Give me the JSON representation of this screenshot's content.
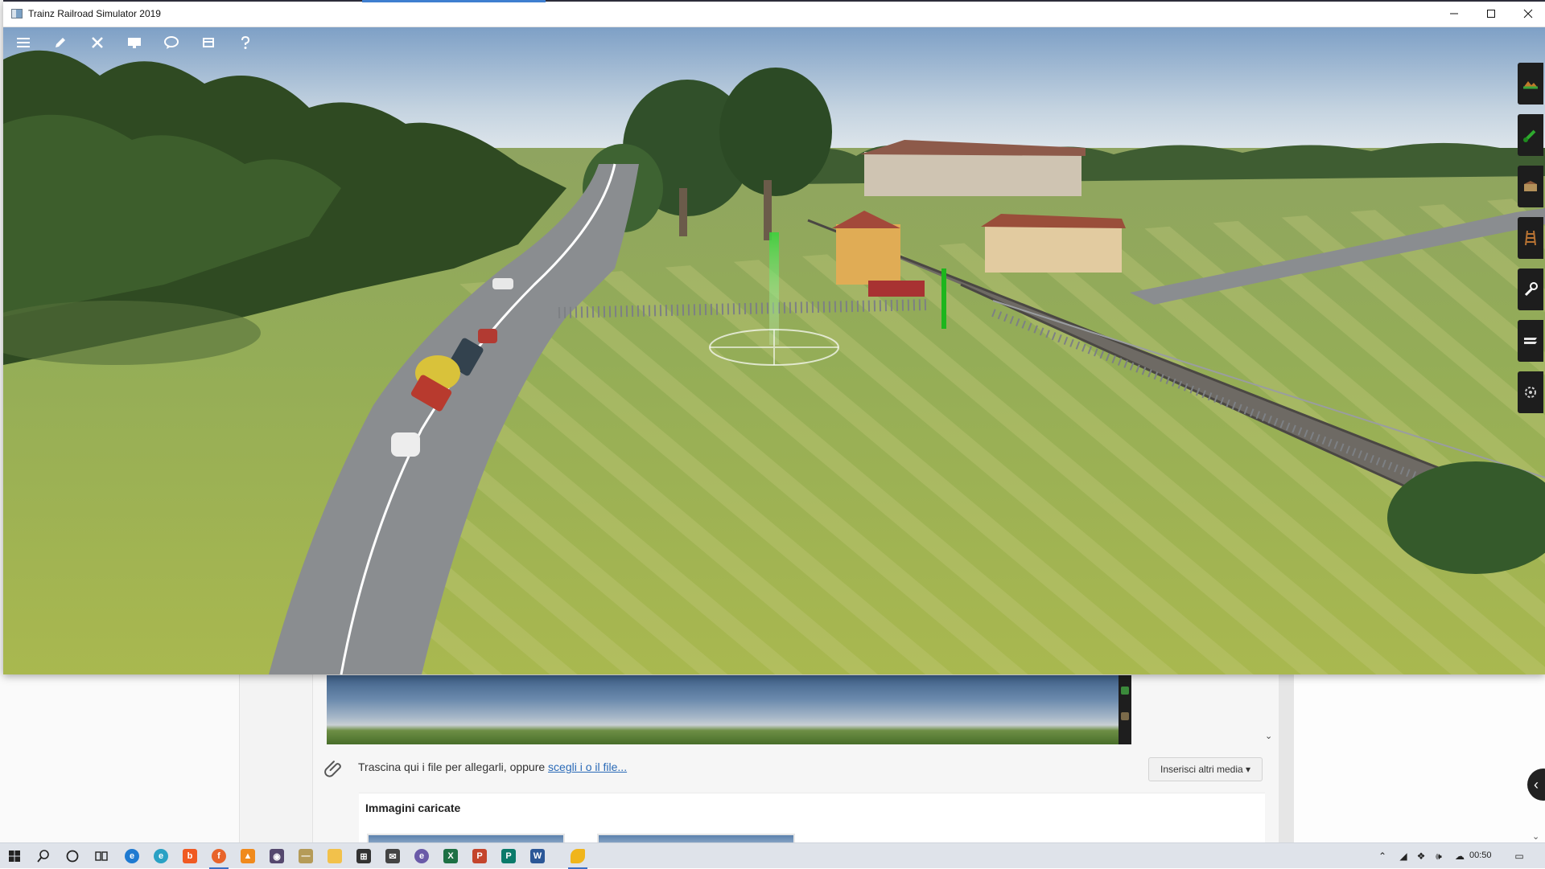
{
  "window": {
    "title": "Trainz Railroad Simulator 2019",
    "controls": {
      "minimize": "minimize",
      "maximize": "maximize",
      "close": "close"
    }
  },
  "game_toolbar": {
    "items": [
      {
        "icon": "menu-icon"
      },
      {
        "icon": "edit-icon"
      },
      {
        "icon": "tools-icon"
      },
      {
        "icon": "monitor-icon"
      },
      {
        "icon": "chat-icon"
      },
      {
        "icon": "layers-icon"
      },
      {
        "icon": "help-icon"
      }
    ]
  },
  "tool_palette": {
    "items": [
      {
        "icon": "terrain-tool-icon"
      },
      {
        "icon": "paint-tool-icon"
      },
      {
        "icon": "objects-tool-icon"
      },
      {
        "icon": "track-tool-icon"
      },
      {
        "icon": "wrench-tool-icon"
      },
      {
        "icon": "layers-tool-icon"
      },
      {
        "icon": "settings-tool-icon"
      }
    ]
  },
  "browser_page": {
    "attach_text": "Trascina qui i file per allegarli, oppure ",
    "attach_link": "scegli i o il file...",
    "insert_media_button": "Inserisci altri media",
    "uploaded_images_title": "Immagini caricate"
  },
  "taskbar": {
    "apps": [
      {
        "icon": "start-icon"
      },
      {
        "icon": "search-icon"
      },
      {
        "icon": "cortana-icon"
      },
      {
        "icon": "task-view-icon"
      },
      {
        "icon": "edge-icon"
      },
      {
        "icon": "edge-beta-icon"
      },
      {
        "icon": "brave-icon"
      },
      {
        "icon": "firefox-icon"
      },
      {
        "icon": "vlc-icon"
      },
      {
        "icon": "app-icon"
      },
      {
        "icon": "app-icon-2"
      },
      {
        "icon": "file-explorer-icon"
      },
      {
        "icon": "store-icon"
      },
      {
        "icon": "mail-icon"
      },
      {
        "icon": "app-icon-3"
      },
      {
        "icon": "excel-icon"
      },
      {
        "icon": "powerpoint-icon"
      },
      {
        "icon": "publisher-icon"
      },
      {
        "icon": "word-icon"
      },
      {
        "icon": "trainz-icon"
      }
    ],
    "clock": "00:50"
  },
  "colors": {
    "taskbar_active": "#3a6fc6",
    "link": "#2a6ab7",
    "titlebar_accent": "#3f7fd0"
  }
}
